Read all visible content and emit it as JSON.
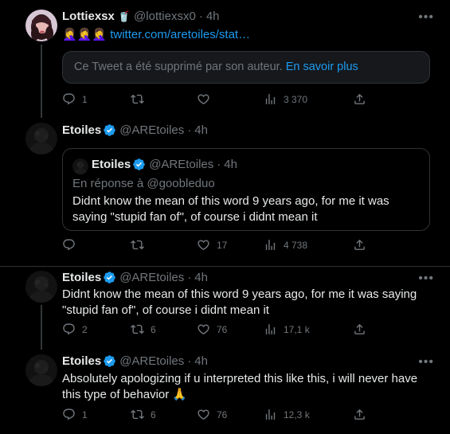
{
  "tweets": [
    {
      "name": "Lottiexsx",
      "name_emoji": "🥤",
      "handle": "@lottiexsx0",
      "time": "4h",
      "emojis": "🤦‍♀️🤦‍♀️🤦‍♀️",
      "link": "twitter.com/aretoiles/stat…",
      "deleted_text": "Ce Tweet a été supprimé par son auteur.",
      "deleted_more": "En savoir plus",
      "replies": "1",
      "retweets": "",
      "likes": "",
      "views": "3 370"
    },
    {
      "name": "Etoiles",
      "handle": "@AREtoiles",
      "time": "4h",
      "quote": {
        "name": "Etoiles",
        "handle": "@AREtoiles",
        "time": "4h",
        "reply_to": "En réponse à @goobleduo",
        "text": "Didnt know the mean of this word 9 years ago, for me it was saying \"stupid fan of\", of course i didnt mean it"
      },
      "replies": "",
      "retweets": "",
      "likes": "17",
      "views": "4 738"
    },
    {
      "name": "Etoiles",
      "handle": "@AREtoiles",
      "time": "4h",
      "text": "Didnt know the mean of this word 9 years ago, for me it was saying \"stupid fan of\", of course i didnt mean it",
      "replies": "2",
      "retweets": "6",
      "likes": "76",
      "views": "17,1 k"
    },
    {
      "name": "Etoiles",
      "handle": "@AREtoiles",
      "time": "4h",
      "text": "Absolutely apologizing if u interpreted this like this, i will never have this type of behavior 🙏",
      "replies": "1",
      "retweets": "6",
      "likes": "76",
      "views": "12,3 k"
    }
  ],
  "more_icon": "•••",
  "colors": {
    "accent": "#1d9bf0",
    "muted": "#71767b",
    "border": "#2f3336",
    "background": "#000000"
  }
}
